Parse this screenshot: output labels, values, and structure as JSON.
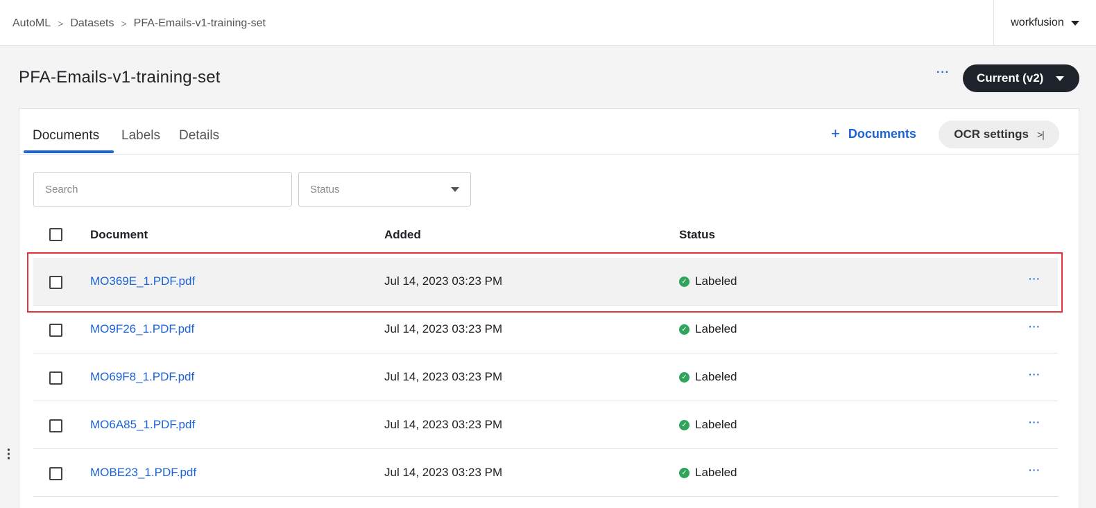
{
  "breadcrumb": [
    "AutoML",
    "Datasets",
    "PFA-Emails-v1-training-set"
  ],
  "user": {
    "name": "workfusion"
  },
  "page": {
    "title": "PFA-Emails-v1-training-set",
    "more_label": "···",
    "version_label": "Current (v2)"
  },
  "tabs": [
    {
      "label": "Documents",
      "active": true
    },
    {
      "label": "Labels",
      "active": false
    },
    {
      "label": "Details",
      "active": false
    }
  ],
  "actions": {
    "add_documents_label": "Documents",
    "ocr_settings_label": "OCR settings"
  },
  "filters": {
    "search_placeholder": "Search",
    "status_placeholder": "Status"
  },
  "table": {
    "columns": [
      "Document",
      "Added",
      "Status"
    ],
    "rows": [
      {
        "document": "MO369E_1.PDF.pdf",
        "added": "Jul 14, 2023 03:23 PM",
        "status": "Labeled",
        "selected": true
      },
      {
        "document": "MO9F26_1.PDF.pdf",
        "added": "Jul 14, 2023 03:23 PM",
        "status": "Labeled",
        "selected": false
      },
      {
        "document": "MO69F8_1.PDF.pdf",
        "added": "Jul 14, 2023 03:23 PM",
        "status": "Labeled",
        "selected": false
      },
      {
        "document": "MO6A85_1.PDF.pdf",
        "added": "Jul 14, 2023 03:23 PM",
        "status": "Labeled",
        "selected": false
      },
      {
        "document": "MOBE23_1.PDF.pdf",
        "added": "Jul 14, 2023 03:23 PM",
        "status": "Labeled",
        "selected": false
      }
    ]
  },
  "colors": {
    "accent": "#1b63d6",
    "success": "#2ea55a",
    "highlight_border": "#e0343c",
    "dark_button": "#1e232b"
  },
  "icons": [
    "chevron-right-icon",
    "caret-down-icon",
    "plus-icon",
    "sidebar-collapse-icon",
    "check-circle-icon",
    "more-horizontal-icon",
    "more-vertical-icon"
  ]
}
